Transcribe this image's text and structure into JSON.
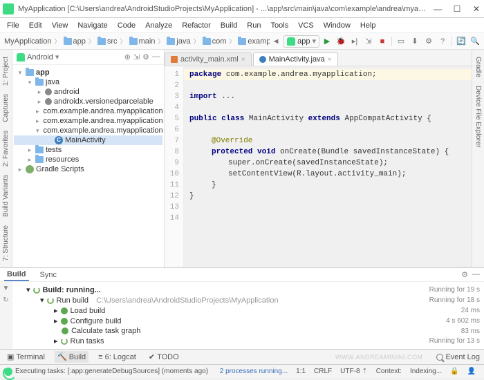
{
  "window": {
    "title": "MyApplication [C:\\Users\\andrea\\AndroidStudioProjects\\MyApplication] - ...\\app\\src\\main\\java\\com\\example\\andrea\\myapplication\\M..."
  },
  "menu": [
    "File",
    "Edit",
    "View",
    "Navigate",
    "Code",
    "Analyze",
    "Refactor",
    "Build",
    "Run",
    "Tools",
    "VCS",
    "Window",
    "Help"
  ],
  "breadcrumbs": [
    "MyApplication",
    "app",
    "src",
    "main",
    "java",
    "com",
    "example"
  ],
  "run_target": "app",
  "project": {
    "view_label": "Android",
    "nodes": {
      "app": "app",
      "java": "java",
      "pkg_android": "android",
      "pkg_androidx": "androidx.versionedparcelable",
      "pkg_app1": "com.example.andrea.myapplication",
      "pkg_app2": "com.example.andrea.myapplication",
      "pkg_app3": "com.example.andrea.myapplication",
      "main_activity": "MainActivity",
      "tests": "tests",
      "resources": "resources",
      "gradle": "Gradle Scripts"
    }
  },
  "editor": {
    "tabs": {
      "xml": "activity_main.xml",
      "java": "MainActivity.java"
    },
    "gutter": [
      "1",
      "2",
      "3",
      "4",
      "5",
      "6",
      "7",
      "8",
      "9",
      "10",
      "11",
      "12",
      "13",
      "14"
    ],
    "code": {
      "pkg_kw": "package",
      "pkg_name": " com.example.andrea.myapplication;",
      "import_kw": "import",
      "import_rest": " ...",
      "l5a": "public class ",
      "l5b": "MainActivity ",
      "l5c": "extends ",
      "l5d": "AppCompatActivity {",
      "l7": "@Override",
      "l8a": "protected void ",
      "l8b": "onCreate(Bundle savedInstanceState) {",
      "l9": "super.onCreate(savedInstanceState);",
      "l10": "setContentView(R.layout.activity_main);",
      "l11": "}",
      "l12": "}"
    }
  },
  "build": {
    "tabs": {
      "build": "Build",
      "sync": "Sync"
    },
    "lines": {
      "running": "Build: running...",
      "run_build": "Run build",
      "run_build_path": "C:\\Users\\andrea\\AndroidStudioProjects\\MyApplication",
      "load_build": "Load build",
      "configure": "Configure build",
      "calc": "Calculate task graph",
      "run_tasks": "Run tasks",
      "t_running": "Running for 19 s",
      "t_run_build": "Running for 18 s",
      "t_load": "24 ms",
      "t_configure": "4 s 602 ms",
      "t_calc": "83 ms",
      "t_run_tasks": "Running for 13 s"
    }
  },
  "bottom_tabs": {
    "terminal": "Terminal",
    "build": "Build",
    "logcat": "6: Logcat",
    "todo": "TODO",
    "event_log": "Event Log"
  },
  "status": {
    "task": "Executing tasks: [:app:generateDebugSources] (moments ago)",
    "processes": "2 processes running...",
    "pos": "1:1",
    "crlf": "CRLF",
    "enc": "UTF-8",
    "context": "Context:",
    "indexing": "Indexing..."
  },
  "watermark": "WWW.ANDREAMININI.COM",
  "side": {
    "project": "1: Project",
    "captures": "Captures",
    "favorites": "2: Favorites",
    "buildvariants": "Build Variants",
    "structure": "7: Structure",
    "gradle": "Gradle",
    "device": "Device File Explorer"
  }
}
